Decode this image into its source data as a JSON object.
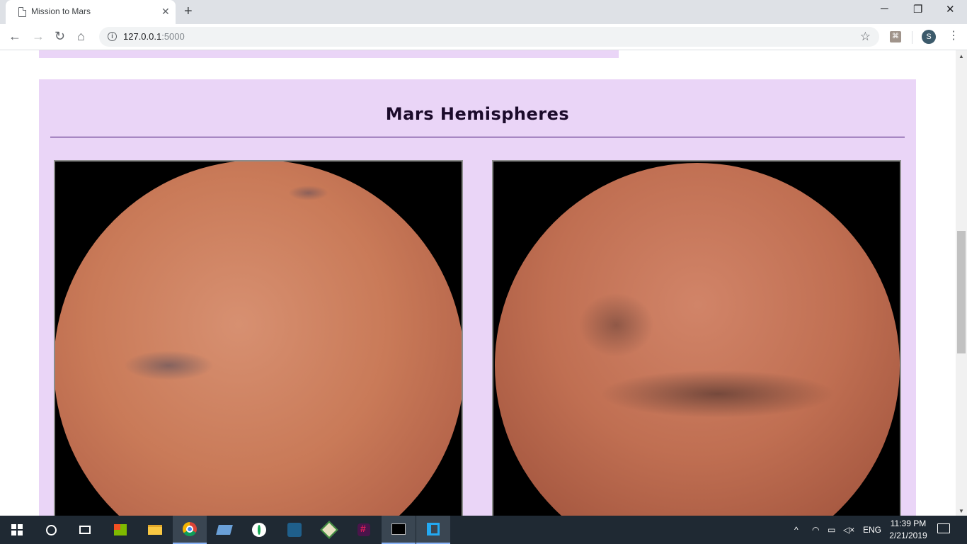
{
  "browser": {
    "tab_title": "Mission to Mars",
    "url_host": "127.0.0.1",
    "url_port": ":5000",
    "profile_initial": "S",
    "controls": {
      "minimize": "─",
      "maximize": "❐",
      "close": "✕",
      "new_tab": "+"
    }
  },
  "page": {
    "section_title": "Mars Hemispheres",
    "hemispheres": [
      {
        "image": "mars-hemisphere-image"
      },
      {
        "image": "mars-hemisphere-image"
      }
    ]
  },
  "taskbar": {
    "apps": [
      "windows-start",
      "cortana",
      "task-view",
      "store",
      "file-explorer",
      "chrome",
      "this-pc",
      "mongodb",
      "mysql-workbench",
      "git",
      "slack",
      "command-prompt",
      "vscode"
    ],
    "language": "ENG",
    "time": "11:39 PM",
    "date": "2/21/2019"
  },
  "colors": {
    "section_bg": "#ead5f7",
    "title_color": "#1b0b2b",
    "rule_color": "#3c0a6e"
  }
}
